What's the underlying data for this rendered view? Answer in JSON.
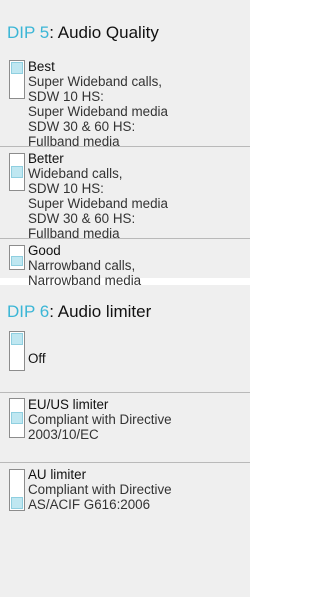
{
  "sections": [
    {
      "dip_label": "DIP 5",
      "heading": ": Audio Quality",
      "options": [
        {
          "title": "Best",
          "description": [
            "Super Wideband calls,",
            "SDW 10 HS:",
            "Super Wideband media",
            "SDW 30 & 60 HS:",
            "Fullband media"
          ],
          "switch_position": "up"
        },
        {
          "title": "Better",
          "description": [
            "Wideband calls,",
            "SDW 10 HS:",
            "Super Wideband media",
            "SDW 30 & 60 HS:",
            "Fullband media"
          ],
          "switch_position": "middle"
        },
        {
          "title": "Good",
          "description": [
            "Narrowband calls,",
            "Narrowband media"
          ],
          "switch_position": "down"
        }
      ]
    },
    {
      "dip_label": "DIP 6",
      "heading": ": Audio limiter",
      "options": [
        {
          "title": "Off",
          "description": [],
          "switch_position": "up"
        },
        {
          "title": "EU/US limiter",
          "description": [
            "Compliant with Directive",
            "2003/10/EC"
          ],
          "switch_position": "middle"
        },
        {
          "title": "AU limiter",
          "description": [
            "Compliant with Directive",
            "AS/ACIF G616:2006"
          ],
          "switch_position": "down"
        }
      ]
    }
  ],
  "colors": {
    "dip_accent": "#3bb6d6",
    "panel_background": "#efefef",
    "switch_knob": "#bfe7f1"
  }
}
